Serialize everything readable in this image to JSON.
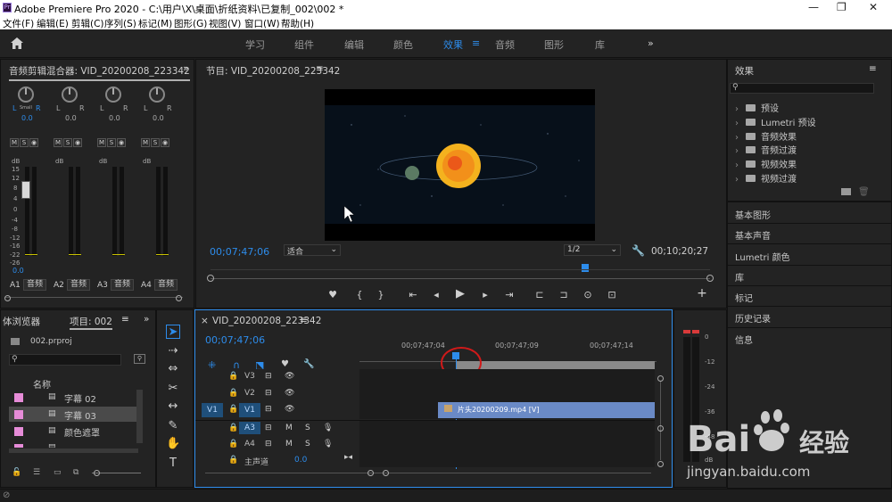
{
  "titlebar": {
    "title": "Adobe Premiere Pro 2020 - C:\\用户\\X\\桌面\\折纸资料\\已复制_002\\002 *",
    "app_icon": "Pr",
    "minimize": "—",
    "maximize": "❐",
    "close": "✕"
  },
  "menu": [
    "文件(F)",
    "编辑(E)",
    "剪辑(C)",
    "序列(S)",
    "标记(M)",
    "图形(G)",
    "视图(V)",
    "窗口(W)",
    "帮助(H)"
  ],
  "workspaces": [
    "学习",
    "组件",
    "编辑",
    "颜色",
    "效果",
    "音频",
    "图形",
    "库"
  ],
  "workspace_active": "效果",
  "workspace_more": "»",
  "mixer": {
    "title": "音频剪辑混合器: VID_20200208_223342",
    "lr": "L",
    "rr": "R",
    "small": "Small",
    "value": "0.0",
    "m": "M",
    "s": "S",
    "r": "◉",
    "db": "dB",
    "scale": [
      "15",
      "12",
      "8",
      "4",
      "0",
      "-4",
      "-8",
      "-12",
      "-16",
      "-22",
      "-26",
      "-∞"
    ],
    "fader_value": "0.0",
    "tracks": [
      {
        "id": "A1",
        "label": "音频"
      },
      {
        "id": "A2",
        "label": "音频"
      },
      {
        "id": "A3",
        "label": "音频"
      },
      {
        "id": "A4",
        "label": "音频"
      }
    ]
  },
  "program": {
    "title": "节目: VID_20200208_223342",
    "menu_icon": "≡",
    "timecode_left": "00;07;47;06",
    "fit": "适合",
    "resolution": "1/2",
    "timecode_right": "00;10;20;27",
    "transport": [
      "♥",
      "{",
      "}",
      "⇤",
      "◂",
      "▶",
      "▸",
      "⇥",
      "⊏",
      "⊐",
      "⊙",
      "⊡",
      "+"
    ]
  },
  "effects": {
    "title": "效果",
    "menu_icon": "≡",
    "items": [
      "预设",
      "Lumetri 预设",
      "音频效果",
      "音频过渡",
      "视频效果",
      "视频过渡"
    ],
    "panels": [
      "基本图形",
      "基本声音",
      "Lumetri 颜色",
      "库",
      "标记",
      "历史记录",
      "信息"
    ]
  },
  "project": {
    "tab_browser": "体浏览器",
    "tab_project": "项目: 002",
    "menu_icon": "≡",
    "file": "002.prproj",
    "column_name": "名称",
    "items": [
      "字幕 02",
      "字幕 03",
      "颜色遮罩",
      "一"
    ]
  },
  "timeline": {
    "close_icon": "×",
    "title": "VID_20200208_223342",
    "menu_icon": "≡",
    "timecode": "00;07;47;06",
    "ruler": [
      "00;07;47;04",
      "00;07;47;09",
      "00;07;47;14"
    ],
    "tracks_v": [
      "V3",
      "V2",
      "V1"
    ],
    "tracks_a": [
      "A3",
      "A4"
    ],
    "master": "主声道",
    "master_value": "0.0",
    "source_v1": "V1",
    "clip_name": "片头20200209.mp4 [V]",
    "m": "M",
    "s": "S"
  },
  "audiometer": {
    "scale": [
      "0",
      "-12",
      "-24",
      "-36",
      "-48",
      "dB"
    ]
  },
  "watermark": {
    "brand": "Bai du 经验",
    "url": "jingyan.baidu.com"
  },
  "colors": {
    "accent": "#2d8ceb",
    "panel": "#232323",
    "clip": "#6a8ac6",
    "pink": "#e68cd8",
    "red": "#d83a3a"
  }
}
